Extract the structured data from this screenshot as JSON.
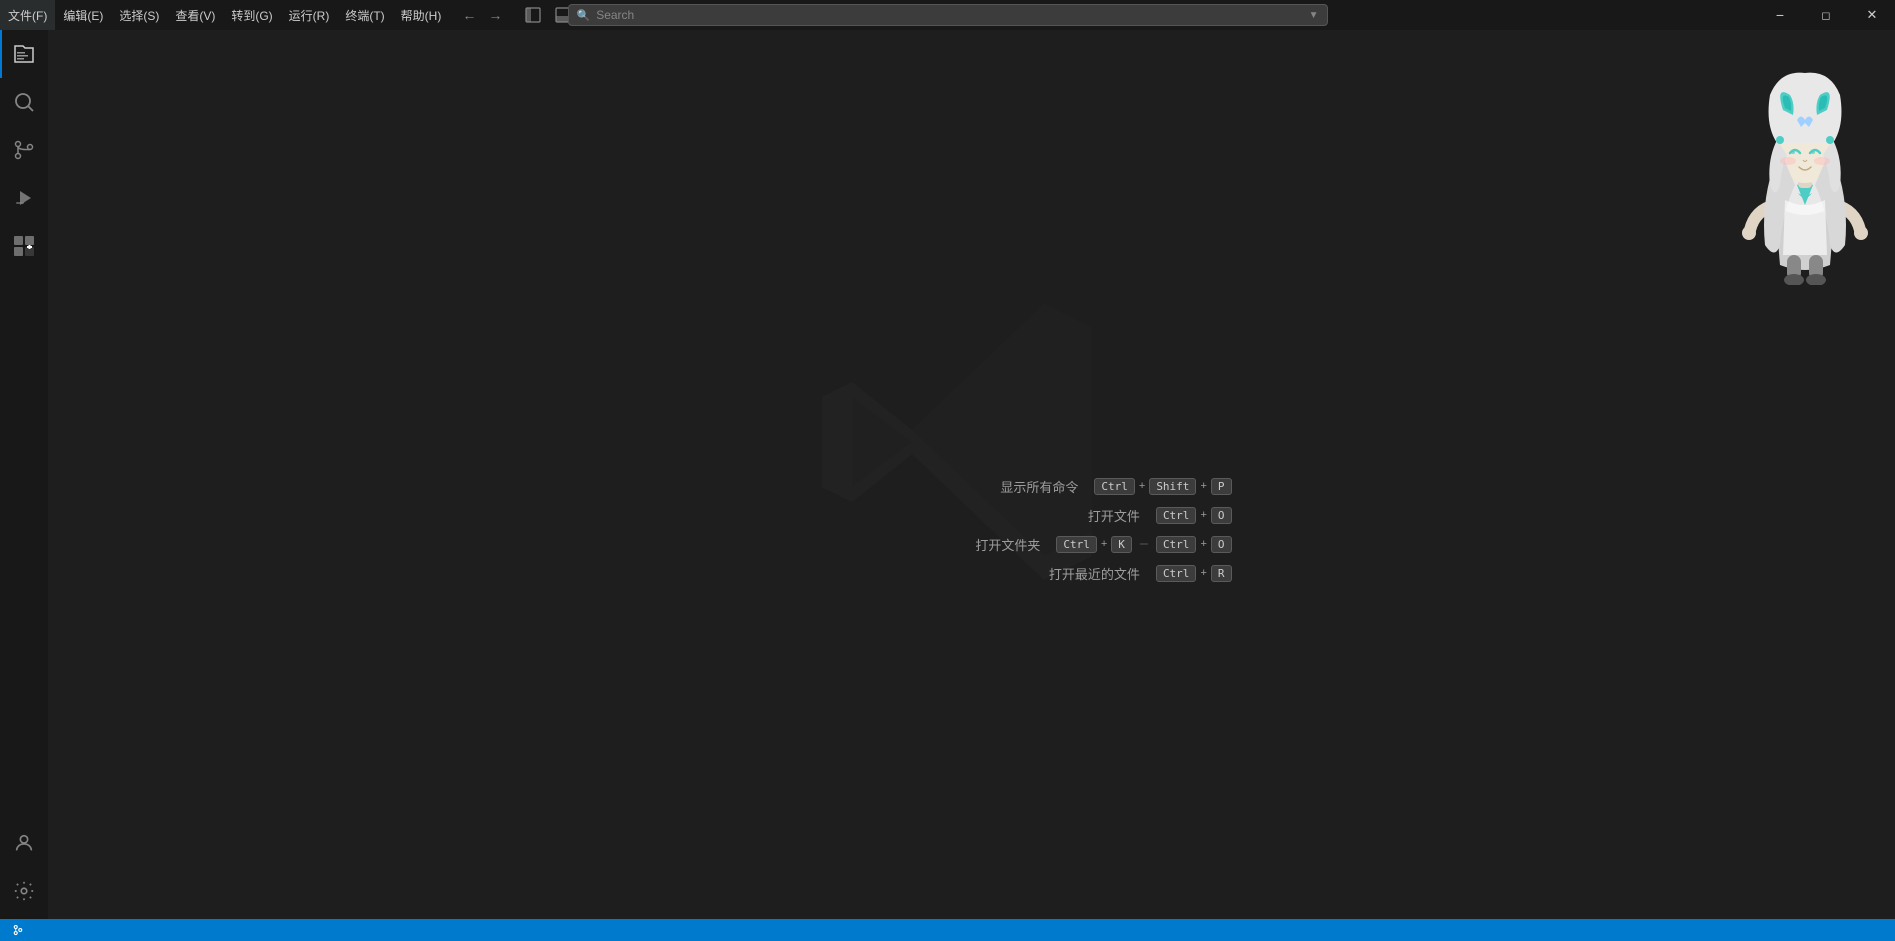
{
  "titlebar": {
    "menu": [
      {
        "label": "文件(F)",
        "id": "file"
      },
      {
        "label": "编辑(E)",
        "id": "edit"
      },
      {
        "label": "选择(S)",
        "id": "selection"
      },
      {
        "label": "查看(V)",
        "id": "view"
      },
      {
        "label": "转到(G)",
        "id": "goto"
      },
      {
        "label": "运行(R)",
        "id": "run"
      },
      {
        "label": "终端(T)",
        "id": "terminal"
      },
      {
        "label": "帮助(H)",
        "id": "help"
      }
    ],
    "search_placeholder": "Search",
    "back_btn": "←",
    "forward_btn": "→"
  },
  "activity_bar": {
    "items": [
      {
        "id": "explorer",
        "tooltip": "资源管理器"
      },
      {
        "id": "search",
        "tooltip": "搜索"
      },
      {
        "id": "git",
        "tooltip": "源代码管理"
      },
      {
        "id": "run",
        "tooltip": "运行和调试"
      },
      {
        "id": "extensions",
        "tooltip": "扩展"
      }
    ],
    "bottom_items": [
      {
        "id": "account",
        "tooltip": "账户"
      },
      {
        "id": "settings",
        "tooltip": "管理"
      }
    ]
  },
  "welcome": {
    "shortcuts": [
      {
        "label": "显示所有命令",
        "keys": [
          "Ctrl",
          "+",
          "Shift",
          "+",
          "P"
        ]
      },
      {
        "label": "打开文件",
        "keys": [
          "Ctrl",
          "+",
          "O"
        ]
      },
      {
        "label": "打开文件夹",
        "keys_group1": [
          "Ctrl",
          "+",
          "K"
        ],
        "keys_group2": [
          "Ctrl",
          "+",
          "O"
        ]
      },
      {
        "label": "打开最近的文件",
        "keys": [
          "Ctrl",
          "+",
          "R"
        ]
      }
    ]
  },
  "status_bar": {
    "items": []
  }
}
